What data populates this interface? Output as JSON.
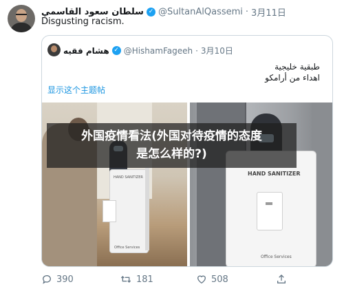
{
  "tweet": {
    "author_name": "سلطان سعود القاسمي",
    "author_handle": "@SultanAlQassemi",
    "separator": "·",
    "date": "3月11日",
    "text": "Disgusting racism."
  },
  "quoted": {
    "author_name": "هشام فقيه",
    "author_handle": "@HishamFageeh",
    "separator": "·",
    "date": "3月10日",
    "arabic_line1": "طبقية خليجية",
    "arabic_line2": "اهداء من أرامكو",
    "show_thread": "显示这个主题帖",
    "photo_labels": {
      "left_sign": "HAND SANITIZER",
      "left_bottom": "Office Services",
      "right_sign": "HAND SANITIZER",
      "right_bottom": "Office Services"
    }
  },
  "overlay": {
    "line1": "外国疫情看法(外国对待疫情的态度",
    "line2": "是怎么样的?)"
  },
  "actions": {
    "reply_count": "390",
    "retweet_count": "181",
    "like_count": "508"
  },
  "icons": {
    "verified": "verified-badge-icon",
    "reply": "reply-icon",
    "retweet": "retweet-icon",
    "like": "heart-icon",
    "share": "share-icon"
  },
  "colors": {
    "link": "#1b95e0",
    "muted": "#657786",
    "verified": "#1da1f2"
  }
}
